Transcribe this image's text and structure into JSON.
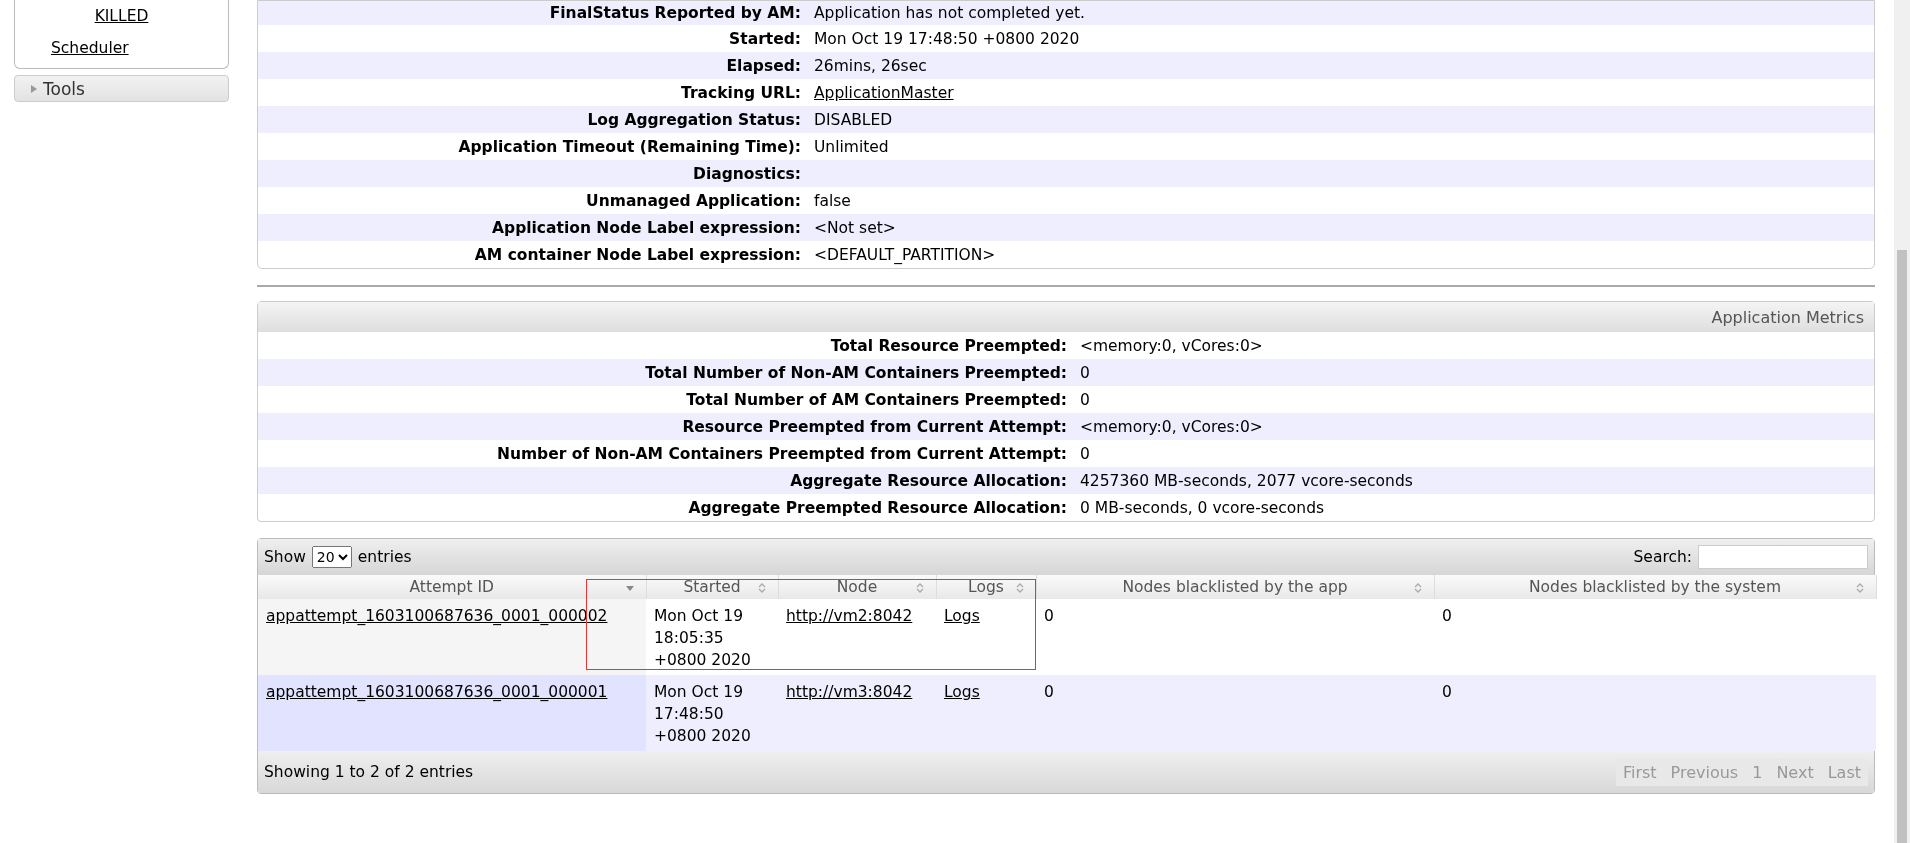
{
  "sidebar": {
    "links": [
      "KILLED",
      "Scheduler"
    ],
    "tools": {
      "label": "Tools",
      "expanded": false
    }
  },
  "app_overview": {
    "rows": [
      {
        "label": "FinalStatus Reported by AM:",
        "value": "Application has not completed yet.",
        "kind": "text"
      },
      {
        "label": "Started:",
        "value": "Mon Oct 19 17:48:50 +0800 2020",
        "kind": "text"
      },
      {
        "label": "Elapsed:",
        "value": "26mins, 26sec",
        "kind": "text"
      },
      {
        "label": "Tracking URL:",
        "value": "ApplicationMaster",
        "kind": "link"
      },
      {
        "label": "Log Aggregation Status:",
        "value": "DISABLED",
        "kind": "text"
      },
      {
        "label": "Application Timeout (Remaining Time):",
        "value": "Unlimited",
        "kind": "text"
      },
      {
        "label": "Diagnostics:"
      },
      {
        "label": "Unmanaged Application:",
        "value": "false",
        "kind": "text"
      },
      {
        "label": "Application Node Label expression:",
        "value": "<Not set>",
        "kind": "text"
      },
      {
        "label": "AM container Node Label expression:",
        "value": "<DEFAULT_PARTITION>",
        "kind": "text"
      }
    ]
  },
  "application_metrics": {
    "title": "Application Metrics",
    "rows": [
      {
        "label": "Total Resource Preempted:",
        "value": "<memory:0, vCores:0>"
      },
      {
        "label": "Total Number of Non-AM Containers Preempted:",
        "value": "0"
      },
      {
        "label": "Total Number of AM Containers Preempted:",
        "value": "0"
      },
      {
        "label": "Resource Preempted from Current Attempt:",
        "value": "<memory:0, vCores:0>"
      },
      {
        "label": "Number of Non-AM Containers Preempted from Current Attempt:",
        "value": "0"
      },
      {
        "label": "Aggregate Resource Allocation:",
        "value": "4257360 MB-seconds, 2077 vcore-seconds"
      },
      {
        "label": "Aggregate Preempted Resource Allocation:",
        "value": "0 MB-seconds, 0 vcore-seconds"
      }
    ]
  },
  "attempts": {
    "show_label": "Show",
    "page_size": "20",
    "entries_label": "entries",
    "search_label": "Search:",
    "columns": [
      {
        "label": "Attempt ID",
        "sorted": true
      },
      {
        "label": "Started",
        "sorted": false
      },
      {
        "label": "Node",
        "sorted": false
      },
      {
        "label": "Logs",
        "sorted": false
      },
      {
        "label": "Nodes blacklisted by the app",
        "sorted": false
      },
      {
        "label": "Nodes blacklisted by the system",
        "sorted": false
      }
    ],
    "rows": [
      {
        "attempt_id": "appattempt_1603100687636_0001_000002",
        "started": [
          "Mon Oct 19",
          "18:05:35",
          "+0800 2020"
        ],
        "node": "http://vm2:8042",
        "logs": "Logs",
        "blacklisted_app": "0",
        "blacklisted_system": "0"
      },
      {
        "attempt_id": "appattempt_1603100687636_0001_000001",
        "started": [
          "Mon Oct 19",
          "17:48:50",
          "+0800 2020"
        ],
        "node": "http://vm3:8042",
        "logs": "Logs",
        "blacklisted_app": "0",
        "blacklisted_system": "0"
      }
    ],
    "info": "Showing 1 to 2 of 2 entries",
    "pagination": [
      {
        "label": "First",
        "disabled": true
      },
      {
        "label": "Previous",
        "disabled": true
      },
      {
        "label": "1",
        "disabled": true
      },
      {
        "label": "Next",
        "disabled": true
      },
      {
        "label": "Last",
        "disabled": true
      }
    ]
  }
}
